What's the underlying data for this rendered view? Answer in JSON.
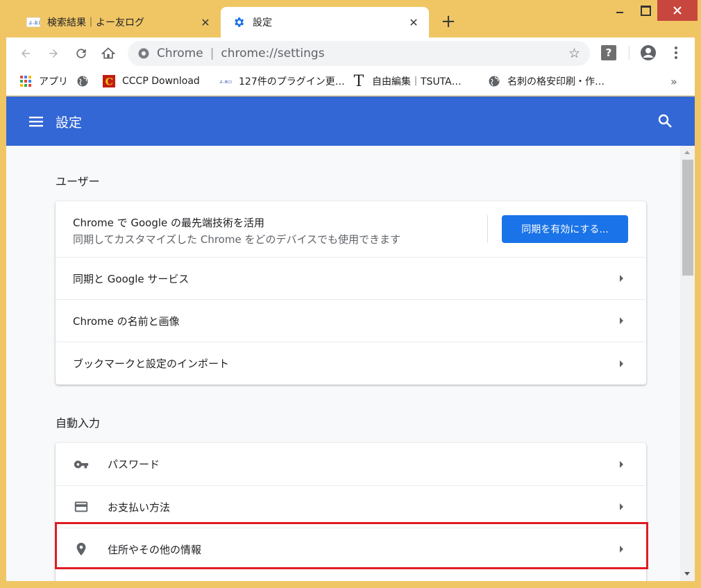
{
  "tabs": [
    {
      "title": "検索結果｜よー友ログ",
      "favicon": "yotomo-logo",
      "active": false
    },
    {
      "title": "設定",
      "favicon": "gear-icon",
      "active": true
    }
  ],
  "toolbar": {
    "site_label": "Chrome",
    "separator": "|",
    "url": "chrome://settings"
  },
  "bookmarks": [
    {
      "label": "アプリ",
      "icon": "apps-grid-icon"
    },
    {
      "label": "",
      "icon": "globe-icon"
    },
    {
      "label": "CCCP Download",
      "icon": "cccp-logo-icon"
    },
    {
      "label": "127件のプラグイン更…",
      "icon": "yotomo-logo"
    },
    {
      "label": "自由編集｜TSUTA…",
      "icon": "t-logo-icon"
    },
    {
      "label": "名刺の格安印刷・作…",
      "icon": "globe-icon"
    }
  ],
  "bookmarks_more": "»",
  "header": {
    "title": "設定"
  },
  "sections": {
    "user": {
      "title": "ユーザー",
      "sync_title": "Chrome で Google の最先端技術を活用",
      "sync_subtitle": "同期してカスタマイズした Chrome をどのデバイスでも使用できます",
      "sync_button": "同期を有効にする...",
      "rows": [
        "同期と Google サービス",
        "Chrome の名前と画像",
        "ブックマークと設定のインポート"
      ]
    },
    "autofill": {
      "title": "自動入力",
      "rows": [
        {
          "label": "パスワード",
          "icon": "key-icon"
        },
        {
          "label": "お支払い方法",
          "icon": "credit-card-icon"
        },
        {
          "label": "住所やその他の情報",
          "icon": "location-pin-icon"
        }
      ]
    }
  },
  "colors": {
    "frame": "#f0c665",
    "header": "#3367d6",
    "accent_button": "#1a73e8",
    "highlight": "#e01b24"
  }
}
